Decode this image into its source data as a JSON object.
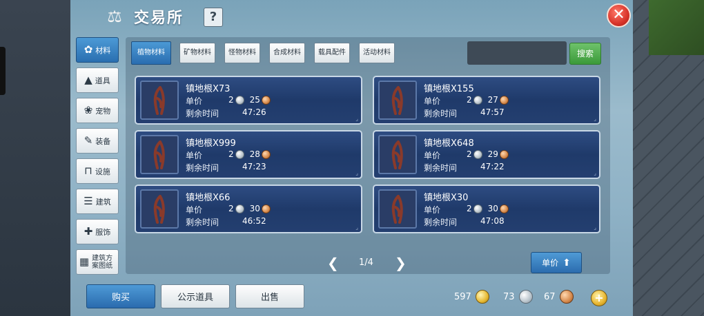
{
  "header": {
    "title": "交易所",
    "help_label": "?",
    "close_label": "✕"
  },
  "sidebar": {
    "items": [
      {
        "label": "材料",
        "icon": "flower-icon",
        "glyph": "✿",
        "active": true
      },
      {
        "label": "道具",
        "icon": "flask-icon",
        "glyph": "▲",
        "active": false
      },
      {
        "label": "宠物",
        "icon": "paw-icon",
        "glyph": "❀",
        "active": false
      },
      {
        "label": "装备",
        "icon": "weapon-icon",
        "glyph": "✎",
        "active": false
      },
      {
        "label": "设施",
        "icon": "facility-icon",
        "glyph": "⊓",
        "active": false
      },
      {
        "label": "建筑",
        "icon": "building-icon",
        "glyph": "☰",
        "active": false
      },
      {
        "label": "服饰",
        "icon": "clothing-icon",
        "glyph": "✚",
        "active": false
      },
      {
        "label": "建筑方案图纸",
        "icon": "blueprint-icon",
        "glyph": "▦",
        "active": false
      }
    ]
  },
  "category_tabs": [
    {
      "label": "植物材料",
      "active": true
    },
    {
      "label": "矿物材料",
      "active": false
    },
    {
      "label": "怪物材料",
      "active": false
    },
    {
      "label": "合成材料",
      "active": false
    },
    {
      "label": "载具配件",
      "active": false
    },
    {
      "label": "活动材料",
      "active": false
    }
  ],
  "search": {
    "button_label": "搜索",
    "value": ""
  },
  "listing_labels": {
    "price": "单价",
    "time_left": "剩余时间"
  },
  "listings": [
    {
      "name": "镇地根X73",
      "price_silver": "2",
      "price_copper": "25",
      "time_left": "47:26"
    },
    {
      "name": "镇地根X155",
      "price_silver": "2",
      "price_copper": "27",
      "time_left": "47:57"
    },
    {
      "name": "镇地根X999",
      "price_silver": "2",
      "price_copper": "28",
      "time_left": "47:23"
    },
    {
      "name": "镇地根X648",
      "price_silver": "2",
      "price_copper": "29",
      "time_left": "47:22"
    },
    {
      "name": "镇地根X66",
      "price_silver": "2",
      "price_copper": "30",
      "time_left": "46:52"
    },
    {
      "name": "镇地根X30",
      "price_silver": "2",
      "price_copper": "30",
      "time_left": "47:08"
    }
  ],
  "pagination": {
    "current": "1/4",
    "prev": "❮",
    "next": "❯"
  },
  "sort": {
    "label": "单价"
  },
  "footer": {
    "buy_label": "购买",
    "public_label": "公示道具",
    "sell_label": "出售",
    "gold": "597",
    "silver": "73",
    "copper": "67",
    "plus_label": "+"
  }
}
